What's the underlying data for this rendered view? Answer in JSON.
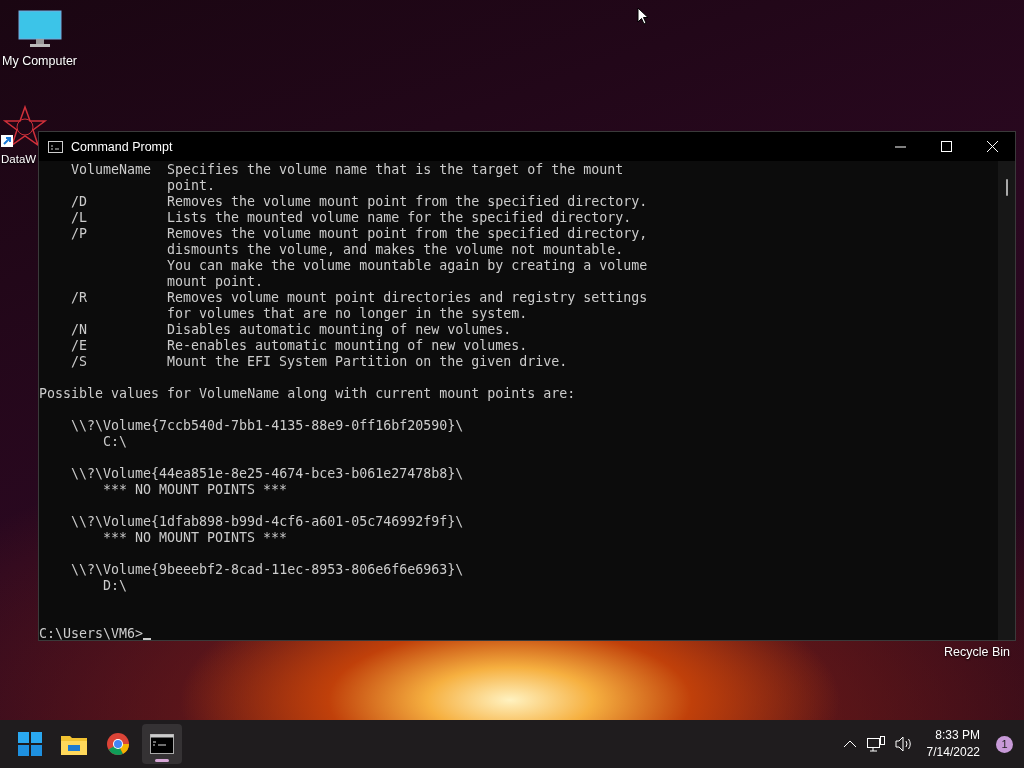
{
  "desktop_icons": [
    {
      "label": "My Computer",
      "kind": "monitor"
    },
    {
      "label": "DataW",
      "kind": "star"
    },
    {
      "label": "Recycle Bin",
      "kind": "bin"
    }
  ],
  "window": {
    "title": "Command Prompt",
    "options": [
      {
        "switch": "VolumeName",
        "lines": [
          "Specifies the volume name that is the target of the mount",
          "point."
        ]
      },
      {
        "switch": "/D",
        "lines": [
          "Removes the volume mount point from the specified directory."
        ]
      },
      {
        "switch": "/L",
        "lines": [
          "Lists the mounted volume name for the specified directory."
        ]
      },
      {
        "switch": "/P",
        "lines": [
          "Removes the volume mount point from the specified directory,",
          "dismounts the volume, and makes the volume not mountable.",
          "You can make the volume mountable again by creating a volume",
          "mount point."
        ]
      },
      {
        "switch": "/R",
        "lines": [
          "Removes volume mount point directories and registry settings",
          "for volumes that are no longer in the system."
        ]
      },
      {
        "switch": "/N",
        "lines": [
          "Disables automatic mounting of new volumes."
        ]
      },
      {
        "switch": "/E",
        "lines": [
          "Re-enables automatic mounting of new volumes."
        ]
      },
      {
        "switch": "/S",
        "lines": [
          "Mount the EFI System Partition on the given drive."
        ]
      }
    ],
    "summary": "Possible values for VolumeName along with current mount points are:",
    "volumes": [
      {
        "path": "\\\\?\\Volume{7ccb540d-7bb1-4135-88e9-0ff16bf20590}\\",
        "mount": "C:\\"
      },
      {
        "path": "\\\\?\\Volume{44ea851e-8e25-4674-bce3-b061e27478b8}\\",
        "mount": "*** NO MOUNT POINTS ***"
      },
      {
        "path": "\\\\?\\Volume{1dfab898-b99d-4cf6-a601-05c746992f9f}\\",
        "mount": "*** NO MOUNT POINTS ***"
      },
      {
        "path": "\\\\?\\Volume{9beeebf2-8cad-11ec-8953-806e6f6e6963}\\",
        "mount": "D:\\"
      }
    ],
    "prompt": "C:\\Users\\VM6>"
  },
  "taskbar": {
    "apps": [
      {
        "kind": "start",
        "selected": false
      },
      {
        "kind": "folder",
        "selected": false
      },
      {
        "kind": "browser",
        "selected": false
      },
      {
        "kind": "terminal",
        "selected": true
      }
    ],
    "time": "8:33 PM",
    "date": "7/14/2022",
    "notifications": "1"
  }
}
